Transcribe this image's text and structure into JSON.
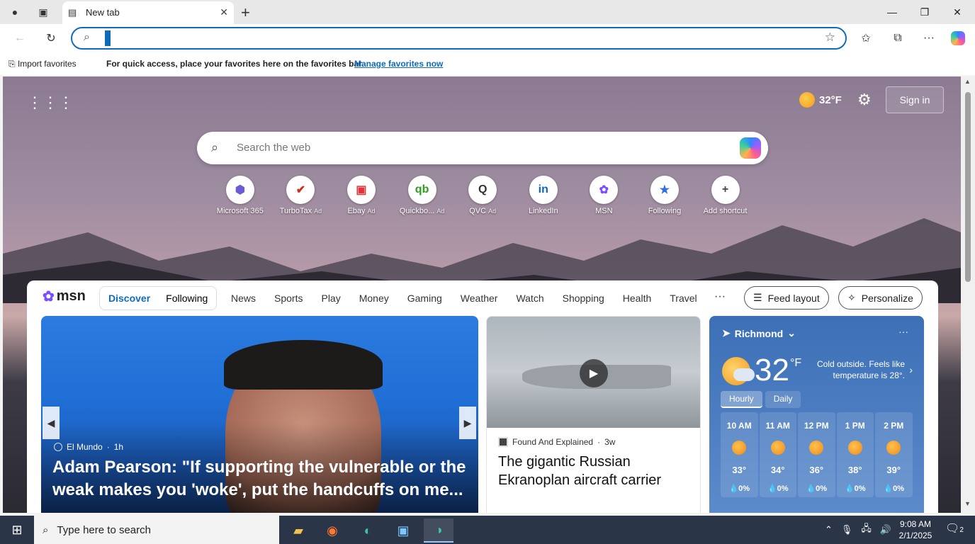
{
  "browser": {
    "tab_title": "New tab",
    "address_value": "",
    "favorites_bar": {
      "import_label": "Import favorites",
      "hint": "For quick access, place your favorites here on the favorites bar.",
      "manage_link": "Manage favorites now"
    }
  },
  "newtab": {
    "weather_chip": "32°F",
    "sign_in": "Sign in",
    "search_placeholder": "Search the web",
    "shortcuts": [
      {
        "label": "Microsoft 365",
        "ad": "",
        "icon": "microsoft-365-icon",
        "glyph": "⬢",
        "color": "#6b5cd6"
      },
      {
        "label": "TurboTax",
        "ad": "Ad",
        "icon": "turbotax-icon",
        "glyph": "✔",
        "color": "#d52b1e"
      },
      {
        "label": "Ebay",
        "ad": "Ad",
        "icon": "ebay-icon",
        "glyph": "▣",
        "color": "#e53238"
      },
      {
        "label": "Quickbo...",
        "ad": "Ad",
        "icon": "quickbooks-icon",
        "glyph": "qb",
        "color": "#2ca01c"
      },
      {
        "label": "QVC",
        "ad": "Ad",
        "icon": "qvc-icon",
        "glyph": "Q",
        "color": "#333333"
      },
      {
        "label": "LinkedIn",
        "ad": "",
        "icon": "linkedin-icon",
        "glyph": "in",
        "color": "#0a66c2"
      },
      {
        "label": "MSN",
        "ad": "",
        "icon": "msn-icon",
        "glyph": "✿",
        "color": "#7a4dff"
      },
      {
        "label": "Following",
        "ad": "",
        "icon": "following-icon",
        "glyph": "★",
        "color": "#2f6fe0"
      },
      {
        "label": "Add shortcut",
        "ad": "",
        "icon": "plus-icon",
        "glyph": "+",
        "color": "#444444"
      }
    ]
  },
  "feed": {
    "logo": "msn",
    "tabs": {
      "discover": "Discover",
      "following": "Following"
    },
    "nav": [
      "News",
      "Sports",
      "Play",
      "Money",
      "Gaming",
      "Weather",
      "Watch",
      "Shopping",
      "Health",
      "Travel"
    ],
    "more": "···",
    "feed_layout": "Feed layout",
    "personalize": "Personalize",
    "hero": {
      "source": "El Mundo",
      "age": "1h",
      "title": "Adam Pearson: \"If supporting the vulnerable or the weak makes you 'woke', put the handcuffs on me..."
    },
    "card2": {
      "source": "Found And Explained",
      "age": "3w",
      "title": "The gigantic Russian Ekranoplan aircraft carrier"
    },
    "weather": {
      "location": "Richmond",
      "temp": "32",
      "unit": "°F",
      "description": "Cold outside. Feels like temperature is 28°.",
      "tabs": {
        "hourly": "Hourly",
        "daily": "Daily"
      },
      "hours": [
        {
          "time": "10 AM",
          "temp": "33°",
          "precip": "0%"
        },
        {
          "time": "11 AM",
          "temp": "34°",
          "precip": "0%"
        },
        {
          "time": "12 PM",
          "temp": "36°",
          "precip": "0%"
        },
        {
          "time": "1 PM",
          "temp": "38°",
          "precip": "0%"
        },
        {
          "time": "2 PM",
          "temp": "39°",
          "precip": "0%"
        }
      ]
    }
  },
  "taskbar": {
    "search_placeholder": "Type here to search",
    "time": "9:08 AM",
    "date": "2/1/2025",
    "notifications": "2"
  }
}
